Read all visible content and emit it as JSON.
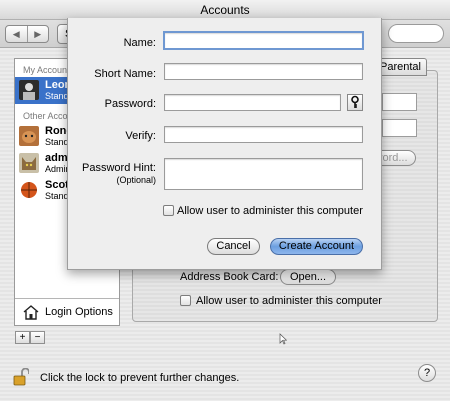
{
  "window": {
    "title": "Accounts"
  },
  "toolbar": {
    "back": "◀",
    "forward": "▶",
    "show_all": "Show All"
  },
  "sidebar": {
    "my_account_header": "My Account",
    "other_accounts_header": "Other Accounts",
    "accounts": [
      {
        "name": "Leonard",
        "type": "Standard",
        "selected": true
      },
      {
        "name": "Ronda",
        "type": "Standard"
      },
      {
        "name": "admin",
        "type": "Admin"
      },
      {
        "name": "Scott",
        "type": "Standard"
      }
    ],
    "login_options": "Login Options",
    "add": "+",
    "remove": "−"
  },
  "pane": {
    "tab_parental_controls": "Parental Controls",
    "change_password": "Change Password...",
    "address_book_label": "Address Book Card:",
    "open_button": "Open...",
    "admin_checkbox_label": "Allow user to administer this computer"
  },
  "sheet": {
    "name_label": "Name:",
    "short_name_label": "Short Name:",
    "password_label": "Password:",
    "verify_label": "Verify:",
    "hint_label": "Password Hint:",
    "hint_optional": "(Optional)",
    "name_value": "",
    "short_name_value": "",
    "password_value": "",
    "verify_value": "",
    "hint_value": "",
    "admin_checkbox_label": "Allow user to administer this computer",
    "cancel": "Cancel",
    "create": "Create Account"
  },
  "footer": {
    "lock_text": "Click the lock to prevent further changes.",
    "help": "?"
  },
  "colors": {
    "selection": "#3a72c9",
    "default_button": "#6c9fe0",
    "focus_ring": "#6f98d2"
  }
}
